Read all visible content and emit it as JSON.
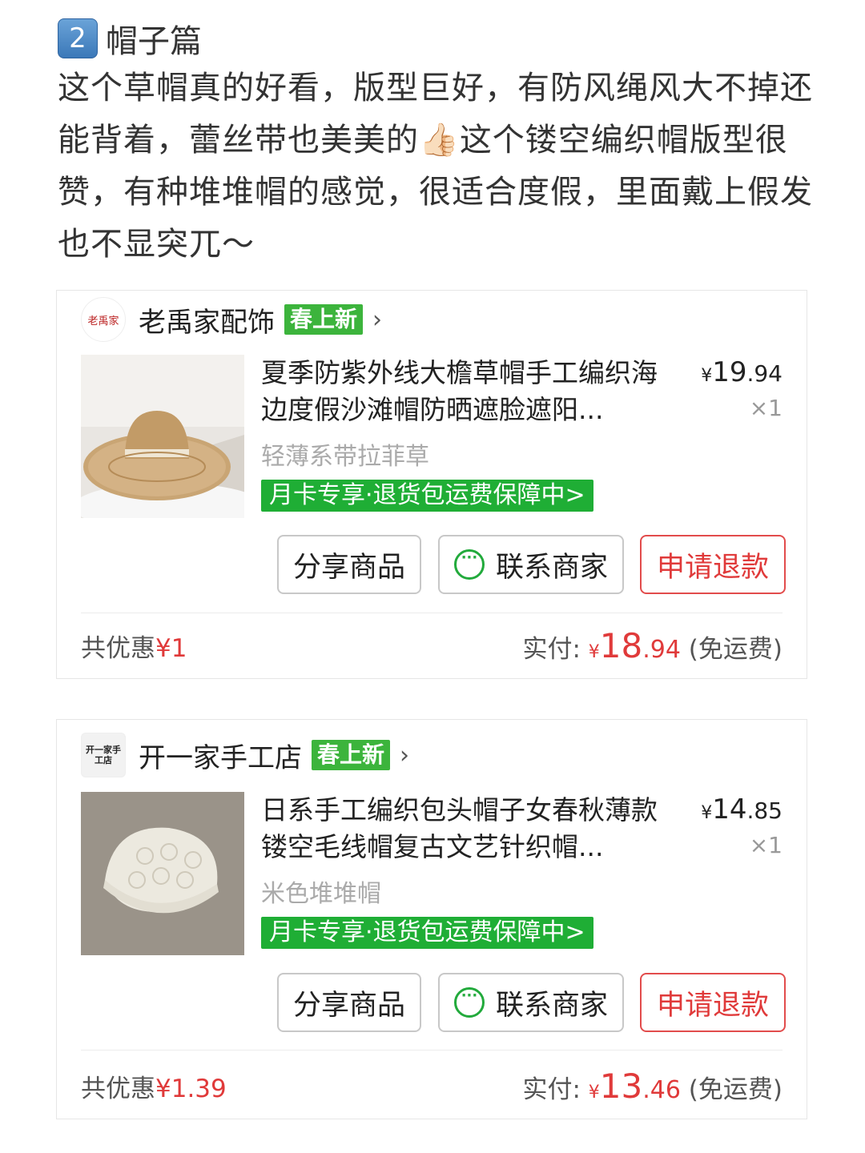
{
  "header": {
    "badge": "2",
    "title": "帽子篇",
    "paragraph": "这个草帽真的好看，版型巨好，有防风绳风大不掉还能背着，蕾丝带也美美的",
    "paragraph2": "这个镂空编织帽版型很赞，有种堆堆帽的感觉，很适合度假，里面戴上假发也不显突兀～",
    "emoji": "👍🏻"
  },
  "orders": [
    {
      "shop_logo_text": "老禹家",
      "shop_name": "老禹家配饰",
      "tag": "春上新",
      "title": "夏季防紫外线大檐草帽手工编织海边度假沙滩帽防晒遮脸遮阳...",
      "price_yen": "¥",
      "price_int": "19",
      "price_dec": ".94",
      "qty": "×1",
      "variant": "轻薄系带拉菲草",
      "promo": "月卡专享·退货包运费保障中>",
      "btn_share": "分享商品",
      "btn_contact": "联系商家",
      "btn_refund": "申请退款",
      "discount_label": "共优惠",
      "discount_value": "¥1",
      "paid_label": "实付:",
      "paid_yen": "¥",
      "paid_int": "18",
      "paid_dec": ".94",
      "paid_note": "(免运费)"
    },
    {
      "shop_logo_text": "开一家手工店",
      "shop_name": "开一家手工店",
      "tag": "春上新",
      "title": "日系手工编织包头帽子女春秋薄款镂空毛线帽复古文艺针织帽...",
      "price_yen": "¥",
      "price_int": "14",
      "price_dec": ".85",
      "qty": "×1",
      "variant": "米色堆堆帽",
      "promo": "月卡专享·退货包运费保障中>",
      "btn_share": "分享商品",
      "btn_contact": "联系商家",
      "btn_refund": "申请退款",
      "discount_label": "共优惠",
      "discount_value": "¥1.39",
      "paid_label": "实付:",
      "paid_yen": "¥",
      "paid_int": "13",
      "paid_dec": ".46",
      "paid_note": "(免运费)"
    }
  ],
  "icons": {
    "chevron": "›",
    "chat": "chat-bubble-icon"
  },
  "colors": {
    "accent_green": "#1fae35",
    "price_red": "#e03a3a"
  }
}
